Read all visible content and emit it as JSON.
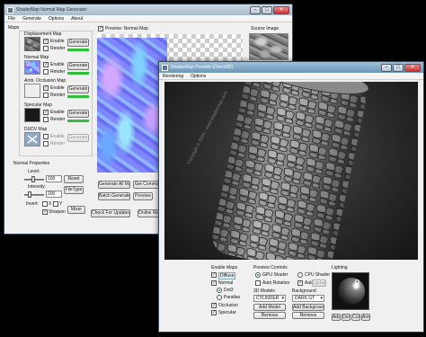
{
  "main_window": {
    "title": "ShaderMap Normal Map Generator",
    "menu": [
      "File",
      "Generate",
      "Options",
      "About"
    ],
    "maps_label": "Maps",
    "preview_label": "Preview: Normal Map",
    "source_label": "Source Image",
    "maps": [
      {
        "name": "Displacement Map",
        "enable": "Enable",
        "render": "Render",
        "generate": "Generate",
        "has_bar": true
      },
      {
        "name": "Normal Map",
        "enable": "Enable",
        "render": "Render",
        "generate": "Generate",
        "has_bar": true
      },
      {
        "name": "Amb. Occlusion Map",
        "enable": "Enable",
        "render": "Render",
        "generate": "Generate",
        "has_bar": true
      },
      {
        "name": "Specular Map",
        "enable": "Enable",
        "render": "Render",
        "generate": "Generate",
        "has_bar": true
      },
      {
        "name": "DUDV Map",
        "enable": "Enable",
        "render": "Render",
        "generate": "Generate",
        "has_bar": false
      }
    ],
    "normal_properties": {
      "heading": "Normal Properties",
      "level_label": "Level:",
      "level_value": "100",
      "intensity_label": "Intensity:",
      "intensity_value": "200",
      "invert_label": "Invert:",
      "invert_x": "X",
      "invert_y": "Y",
      "sharpen_label": "Sharpen",
      "reset": "Reset",
      "filetype": "FileType",
      "mixer": "Mixer"
    },
    "bottom_buttons": [
      "Generate All Maps",
      "Get Command",
      "Batch Generate",
      "Preview",
      "Check For Updates",
      "Online Manual"
    ]
  },
  "preview_window": {
    "title": "ShaderMap Preview (Direct3D)",
    "menu": [
      "Rendering",
      "Options"
    ],
    "watermark": "Copyright © 2009 - www.shadermap.com",
    "enable_maps": {
      "heading": "Enable Maps",
      "items": [
        "Diffuse",
        "Normal",
        "Dot3",
        "Parallax",
        "Occlusion",
        "Specular"
      ]
    },
    "preview_controls": {
      "heading": "Preview Controls",
      "gpu": "GPU Shader",
      "cpu": "CPU Shader",
      "auto_rotation": "Auto Rotation",
      "auto_label": "Auto",
      "update_label": "Update",
      "models_label": "3D Models",
      "model_value": "CYLINDER",
      "add_model": "Add Model",
      "remove_model": "Remove",
      "background_label": "Background",
      "background_value": "DARK GT",
      "add_background": "Add Background",
      "remove_background": "Remove"
    },
    "lighting": {
      "heading": "Lighting",
      "buttons": [
        "Add",
        "Del",
        "Col",
        "Amb"
      ]
    }
  }
}
